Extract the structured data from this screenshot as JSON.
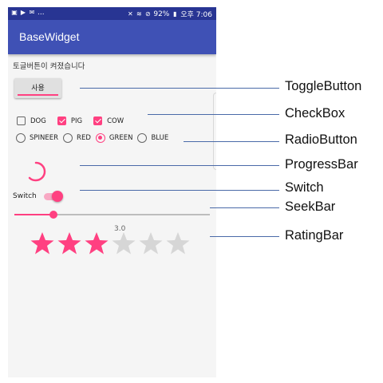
{
  "status_bar": {
    "left_icons": [
      "image-icon",
      "play-icon",
      "message-icon"
    ],
    "ellipsis": "...",
    "battery": "92%",
    "time": "오후 7:06"
  },
  "app": {
    "title": "BaseWidget"
  },
  "toast": "토글버튼이 켜졌습니다",
  "toggle": {
    "label": "사용",
    "checked": true
  },
  "checkboxes": [
    {
      "label": "DOG",
      "checked": false
    },
    {
      "label": "PIG",
      "checked": true
    },
    {
      "label": "COW",
      "checked": true
    }
  ],
  "radios": [
    {
      "label": "SPINEER",
      "selected": false
    },
    {
      "label": "RED",
      "selected": false
    },
    {
      "label": "GREEN",
      "selected": true
    },
    {
      "label": "BLUE",
      "selected": false
    }
  ],
  "switch": {
    "label": "Switch",
    "on": true
  },
  "seekbar": {
    "progress": 0.2
  },
  "rating": {
    "value_text": "3.0",
    "value": 3,
    "max": 6
  },
  "annotations": [
    {
      "label": "ToggleButton"
    },
    {
      "label": "CheckBox"
    },
    {
      "label": "RadioButton"
    },
    {
      "label": "ProgressBar"
    },
    {
      "label": "Switch"
    },
    {
      "label": "SeekBar"
    },
    {
      "label": "RatingBar"
    }
  ],
  "colors": {
    "accent": "#ff4081",
    "primary": "#3f51b5",
    "primary_dark": "#283593"
  }
}
